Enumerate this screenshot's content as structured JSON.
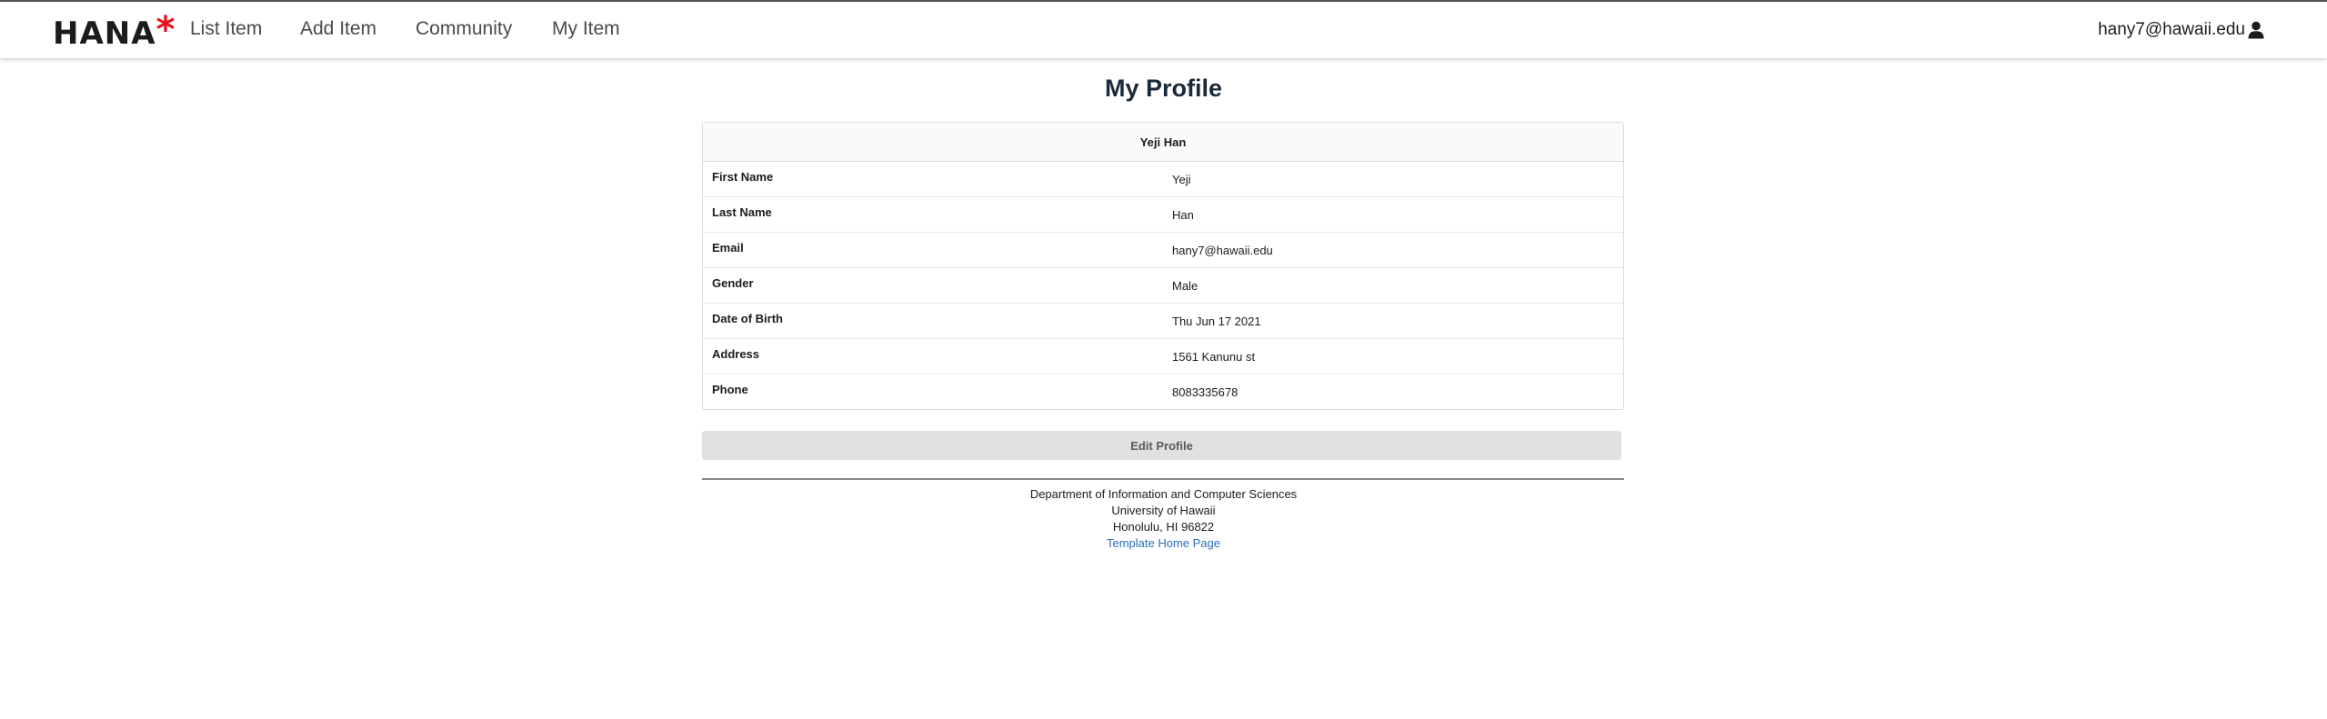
{
  "brand": {
    "name": "HANA",
    "mark": "*"
  },
  "nav": {
    "items": [
      {
        "label": "List Item"
      },
      {
        "label": "Add Item"
      },
      {
        "label": "Community"
      },
      {
        "label": "My Item"
      }
    ],
    "user_email": "hany7@hawaii.edu",
    "user_icon": "user-icon"
  },
  "page": {
    "title": "My Profile"
  },
  "profile": {
    "full_name": "Yeji Han",
    "rows": [
      {
        "label": "First Name",
        "value": "Yeji"
      },
      {
        "label": "Last Name",
        "value": "Han"
      },
      {
        "label": "Email",
        "value": "hany7@hawaii.edu"
      },
      {
        "label": "Gender",
        "value": "Male"
      },
      {
        "label": "Date of Birth",
        "value": "Thu Jun 17 2021"
      },
      {
        "label": "Address",
        "value": "1561 Kanunu st"
      },
      {
        "label": "Phone",
        "value": "8083335678"
      }
    ]
  },
  "actions": {
    "edit_label": "Edit Profile"
  },
  "footer": {
    "line1": "Department of Information and Computer Sciences",
    "line2": "University of Hawaii",
    "line3": "Honolulu, HI 96822",
    "link_label": "Template Home Page"
  },
  "colors": {
    "brand_star": "#e8101a",
    "link": "#2a6ebb",
    "button_bg": "#e0e1e2"
  }
}
